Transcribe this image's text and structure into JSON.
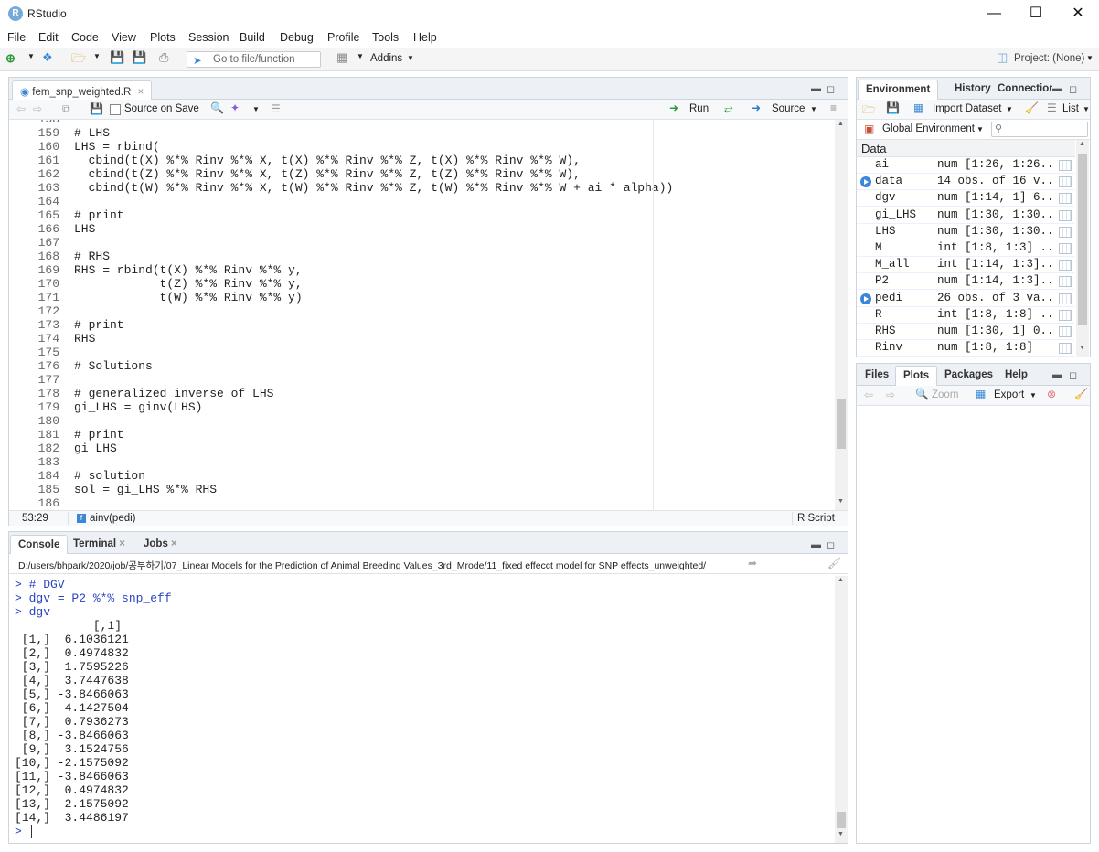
{
  "app": {
    "title": "RStudio"
  },
  "menu": [
    "File",
    "Edit",
    "Code",
    "View",
    "Plots",
    "Session",
    "Build",
    "Debug",
    "Profile",
    "Tools",
    "Help"
  ],
  "toolbar": {
    "goto_placeholder": "Go to file/function",
    "addins": "Addins",
    "project": "Project: (None)"
  },
  "editor": {
    "tab": "fem_snp_weighted.R",
    "source_on_save": "Source on Save",
    "run": "Run",
    "source": "Source",
    "lines": [
      {
        "n": "158",
        "t": ""
      },
      {
        "n": "159",
        "t": "# LHS"
      },
      {
        "n": "160",
        "t": "LHS = rbind("
      },
      {
        "n": "161",
        "t": "  cbind(t(X) %*% Rinv %*% X, t(X) %*% Rinv %*% Z, t(X) %*% Rinv %*% W),"
      },
      {
        "n": "162",
        "t": "  cbind(t(Z) %*% Rinv %*% X, t(Z) %*% Rinv %*% Z, t(Z) %*% Rinv %*% W),"
      },
      {
        "n": "163",
        "t": "  cbind(t(W) %*% Rinv %*% X, t(W) %*% Rinv %*% Z, t(W) %*% Rinv %*% W + ai * alpha))"
      },
      {
        "n": "164",
        "t": ""
      },
      {
        "n": "165",
        "t": "# print"
      },
      {
        "n": "166",
        "t": "LHS"
      },
      {
        "n": "167",
        "t": ""
      },
      {
        "n": "168",
        "t": "# RHS"
      },
      {
        "n": "169",
        "t": "RHS = rbind(t(X) %*% Rinv %*% y,"
      },
      {
        "n": "170",
        "t": "            t(Z) %*% Rinv %*% y,"
      },
      {
        "n": "171",
        "t": "            t(W) %*% Rinv %*% y)"
      },
      {
        "n": "172",
        "t": ""
      },
      {
        "n": "173",
        "t": "# print"
      },
      {
        "n": "174",
        "t": "RHS"
      },
      {
        "n": "175",
        "t": ""
      },
      {
        "n": "176",
        "t": "# Solutions"
      },
      {
        "n": "177",
        "t": ""
      },
      {
        "n": "178",
        "t": "# generalized inverse of LHS"
      },
      {
        "n": "179",
        "t": "gi_LHS = ginv(LHS)"
      },
      {
        "n": "180",
        "t": ""
      },
      {
        "n": "181",
        "t": "# print"
      },
      {
        "n": "182",
        "t": "gi_LHS"
      },
      {
        "n": "183",
        "t": ""
      },
      {
        "n": "184",
        "t": "# solution"
      },
      {
        "n": "185",
        "t": "sol = gi_LHS %*% RHS"
      },
      {
        "n": "186",
        "t": ""
      }
    ],
    "status_pos": "53:29",
    "status_func": "ainv(pedi)",
    "status_type": "R Script"
  },
  "console": {
    "tabs": [
      "Console",
      "Terminal",
      "Jobs"
    ],
    "path": "D:/users/bhpark/2020/job/공부하기/07_Linear Models for the Prediction of Animal Breeding Values_3rd_Mrode/11_fixed effecct model for SNP effects_unweighted/",
    "lines": [
      {
        "p": "> ",
        "t": "# DGV"
      },
      {
        "p": "> ",
        "t": "dgv = P2 %*% snp_eff"
      },
      {
        "p": "> ",
        "t": "dgv"
      },
      {
        "p": "",
        "t": "           [,1]"
      },
      {
        "p": "",
        "t": " [1,]  6.1036121"
      },
      {
        "p": "",
        "t": " [2,]  0.4974832"
      },
      {
        "p": "",
        "t": " [3,]  1.7595226"
      },
      {
        "p": "",
        "t": " [4,]  3.7447638"
      },
      {
        "p": "",
        "t": " [5,] -3.8466063"
      },
      {
        "p": "",
        "t": " [6,] -4.1427504"
      },
      {
        "p": "",
        "t": " [7,]  0.7936273"
      },
      {
        "p": "",
        "t": " [8,] -3.8466063"
      },
      {
        "p": "",
        "t": " [9,]  3.1524756"
      },
      {
        "p": "",
        "t": "[10,] -2.1575092"
      },
      {
        "p": "",
        "t": "[11,] -3.8466063"
      },
      {
        "p": "",
        "t": "[12,]  0.4974832"
      },
      {
        "p": "",
        "t": "[13,] -2.1575092"
      },
      {
        "p": "",
        "t": "[14,]  3.4486197"
      },
      {
        "p": "> ",
        "t": ""
      }
    ]
  },
  "environment": {
    "tabs": [
      "Environment",
      "History",
      "Connection"
    ],
    "import": "Import Dataset",
    "list": "List",
    "scope": "Global Environment",
    "section": "Data",
    "rows": [
      {
        "name": "ai",
        "value": "num [1:26, 1:26...",
        "expand": false
      },
      {
        "name": "data",
        "value": "14 obs. of 16 v...",
        "expand": true
      },
      {
        "name": "dgv",
        "value": "num [1:14, 1] 6...",
        "expand": false
      },
      {
        "name": "gi_LHS",
        "value": "num [1:30, 1:30...",
        "expand": false
      },
      {
        "name": "LHS",
        "value": "num [1:30, 1:30...",
        "expand": false
      },
      {
        "name": "M",
        "value": "int [1:8, 1:3] ...",
        "expand": false
      },
      {
        "name": "M_all",
        "value": "int [1:14, 1:3]...",
        "expand": false
      },
      {
        "name": "P2",
        "value": "num [1:14, 1:3]...",
        "expand": false
      },
      {
        "name": "pedi",
        "value": "26 obs. of 3 va...",
        "expand": true
      },
      {
        "name": "R",
        "value": "int [1:8, 1:8] ...",
        "expand": false
      },
      {
        "name": "RHS",
        "value": "num [1:30, 1] 0...",
        "expand": false
      },
      {
        "name": "Rinv",
        "value": "num [1:8, 1:8]",
        "expand": false
      }
    ]
  },
  "files": {
    "tabs": [
      "Files",
      "Plots",
      "Packages",
      "Help"
    ],
    "zoom": "Zoom",
    "export": "Export"
  }
}
